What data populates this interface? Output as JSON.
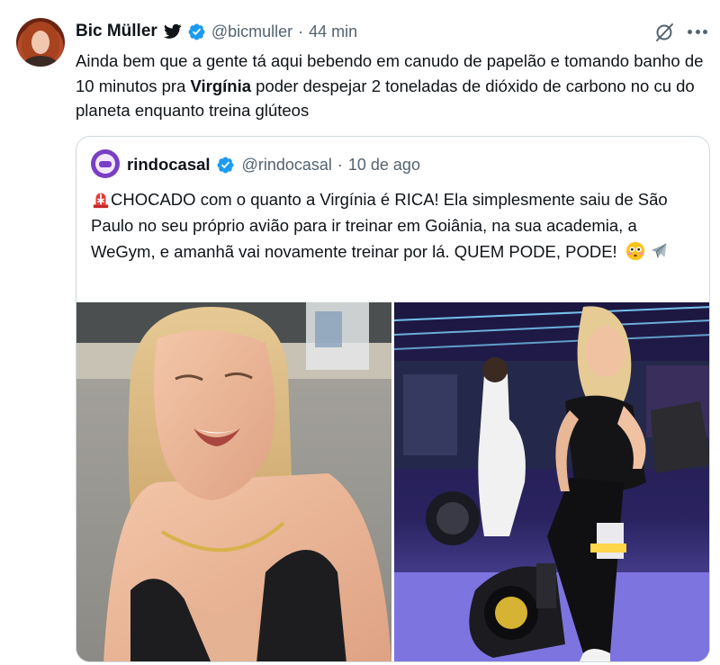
{
  "tweet": {
    "author_name": "Bic Müller",
    "handle": "@bicmuller",
    "separator": "·",
    "time": "44 min",
    "text_before_bold": "Ainda bem que a gente tá aqui bebendo em canudo de papelão e tomando banho de 10 minutos pra ",
    "text_bold": "Virgínia",
    "text_after_bold": " poder despejar 2 toneladas de dióxido de carbono no cu do planeta enquanto treina glúteos"
  },
  "quote": {
    "author_name": "rindocasal",
    "handle": "@rindocasal",
    "separator": "·",
    "date": "10 de ago",
    "text": "CHOCADO com o quanto a Virgínia é RICA! Ela simplesmente saiu de São Paulo no seu próprio avião para ir treinar em Goiânia, na sua academia, a WeGym, e amanhã vai novamente treinar por lá. QUEM PODE, PODE!",
    "leading_icon": "rotating-light-icon",
    "trailing_icons": [
      "flushed-face-icon",
      "airplane-icon"
    ]
  },
  "media": {
    "left_photo": "selfie-outdoors",
    "right_photo": "spin-bike-gym"
  },
  "colors": {
    "verified": "#1d9bf0",
    "text": "#0f1419",
    "secondary": "#536471",
    "border": "#cfd9de",
    "quote_avatar": "#7a3fc4"
  },
  "icons": {
    "bird": "bird-icon",
    "verified": "verified-badge-icon",
    "grok": "grok-icon",
    "more": "more-icon"
  }
}
